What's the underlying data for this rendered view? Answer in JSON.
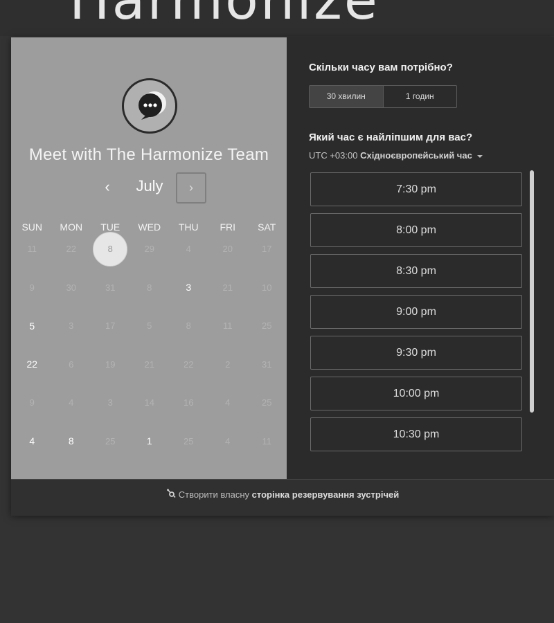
{
  "brand": {
    "logo_text": "Harmonize"
  },
  "profile": {
    "title": "Meet with The Harmonize Team"
  },
  "calendar": {
    "month": "July",
    "prev_label": "‹",
    "next_label": "›",
    "weekdays": [
      "SUN",
      "MON",
      "TUE",
      "WED",
      "THU",
      "FRI",
      "SAT"
    ],
    "weeks": [
      [
        {
          "d": "11",
          "a": false
        },
        {
          "d": "22",
          "a": false
        },
        {
          "d": "8",
          "a": true,
          "s": true
        },
        {
          "d": "29",
          "a": false
        },
        {
          "d": "4",
          "a": false
        },
        {
          "d": "20",
          "a": false
        },
        {
          "d": "17",
          "a": false
        }
      ],
      [
        {
          "d": "9",
          "a": false
        },
        {
          "d": "30",
          "a": false
        },
        {
          "d": "31",
          "a": false
        },
        {
          "d": "8",
          "a": false
        },
        {
          "d": "3",
          "a": true
        },
        {
          "d": "21",
          "a": false
        },
        {
          "d": "10",
          "a": false
        }
      ],
      [
        {
          "d": "5",
          "a": true
        },
        {
          "d": "3",
          "a": false
        },
        {
          "d": "17",
          "a": false
        },
        {
          "d": "5",
          "a": false
        },
        {
          "d": "8",
          "a": false
        },
        {
          "d": "11",
          "a": false
        },
        {
          "d": "25",
          "a": false
        }
      ],
      [
        {
          "d": "22",
          "a": true
        },
        {
          "d": "6",
          "a": false
        },
        {
          "d": "19",
          "a": false
        },
        {
          "d": "21",
          "a": false
        },
        {
          "d": "22",
          "a": false
        },
        {
          "d": "2",
          "a": false
        },
        {
          "d": "31",
          "a": false
        }
      ],
      [
        {
          "d": "9",
          "a": false
        },
        {
          "d": "4",
          "a": false
        },
        {
          "d": "3",
          "a": false
        },
        {
          "d": "14",
          "a": false
        },
        {
          "d": "16",
          "a": false
        },
        {
          "d": "4",
          "a": false
        },
        {
          "d": "25",
          "a": false
        }
      ],
      [
        {
          "d": "4",
          "a": true
        },
        {
          "d": "8",
          "a": true
        },
        {
          "d": "25",
          "a": false
        },
        {
          "d": "1",
          "a": true
        },
        {
          "d": "25",
          "a": false
        },
        {
          "d": "4",
          "a": false
        },
        {
          "d": "11",
          "a": false
        }
      ]
    ]
  },
  "duration": {
    "heading": "Скільки часу вам потрібно?",
    "options": [
      "30 хвилин",
      "1 годин"
    ],
    "selected_index": 0
  },
  "time_picker": {
    "heading": "Який час є найліпшим для вас?",
    "timezone_prefix": "UTC +03:00 ",
    "timezone_name": "Східноєвропейський час",
    "slots": [
      "7:30 pm",
      "8:00 pm",
      "8:30 pm",
      "9:00 pm",
      "9:30 pm",
      "10:00 pm",
      "10:30 pm"
    ]
  },
  "footer": {
    "prefix": "Створити власну",
    "bold": "сторінка резервування зустрічей"
  }
}
